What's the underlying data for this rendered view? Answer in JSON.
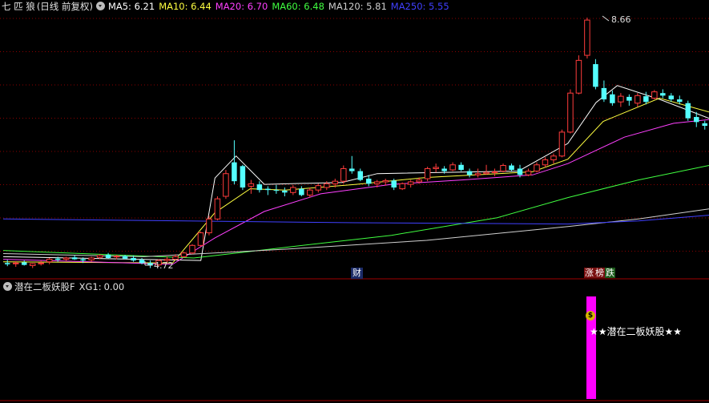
{
  "header": {
    "stock_name": "七 匹 狼",
    "period": "(日线 前复权)",
    "ma": [
      {
        "label": "MA5:",
        "value": "6.21",
        "color": "#ffffff"
      },
      {
        "label": "MA10:",
        "value": "6.44",
        "color": "#ffff40"
      },
      {
        "label": "MA20:",
        "value": "6.70",
        "color": "#ff40ff"
      },
      {
        "label": "MA60:",
        "value": "6.48",
        "color": "#40ff40"
      },
      {
        "label": "MA120:",
        "value": "5.81",
        "color": "#cfcfcf"
      },
      {
        "label": "MA250:",
        "value": "5.55",
        "color": "#4040ff"
      }
    ]
  },
  "indicator": {
    "name": "潜在二板妖股F",
    "xg_label": "XG1:",
    "xg_value": "0.00",
    "signal_text": "★★潜在二板妖股★★",
    "money_glyph": "$"
  },
  "annotations": {
    "high_price": "8.66",
    "low_price": "4.72",
    "tag_finance": "财",
    "tag_limit_1": "涨",
    "tag_limit_2": "榜",
    "tag_limit_3": "跌"
  },
  "colors": {
    "up": "#ff3c3c",
    "down": "#54ffff",
    "grid": "#8b0000",
    "signal_bar": "#ff00ff"
  },
  "chart_data": {
    "type": "candlestick",
    "ylim": [
      4.6,
      8.75
    ],
    "grid": true,
    "candles": [
      [
        4.8,
        4.85,
        4.75,
        4.78
      ],
      [
        4.79,
        4.83,
        4.74,
        4.8
      ],
      [
        4.81,
        4.84,
        4.76,
        4.77
      ],
      [
        4.76,
        4.8,
        4.72,
        4.79
      ],
      [
        4.8,
        4.84,
        4.76,
        4.8
      ],
      [
        4.82,
        4.88,
        4.78,
        4.86
      ],
      [
        4.87,
        4.9,
        4.82,
        4.85
      ],
      [
        4.86,
        4.9,
        4.83,
        4.88
      ],
      [
        4.89,
        4.92,
        4.85,
        4.86
      ],
      [
        4.86,
        4.89,
        4.8,
        4.84
      ],
      [
        4.85,
        4.9,
        4.82,
        4.88
      ],
      [
        4.89,
        4.94,
        4.86,
        4.92
      ],
      [
        4.93,
        4.96,
        4.87,
        4.88
      ],
      [
        4.9,
        4.93,
        4.86,
        4.91
      ],
      [
        4.91,
        4.93,
        4.86,
        4.87
      ],
      [
        4.88,
        4.92,
        4.82,
        4.84
      ],
      [
        4.85,
        4.88,
        4.78,
        4.8
      ],
      [
        4.8,
        4.84,
        4.72,
        4.76
      ],
      [
        4.77,
        4.86,
        4.74,
        4.84
      ],
      [
        4.84,
        4.9,
        4.8,
        4.86
      ],
      [
        4.86,
        4.94,
        4.84,
        4.9
      ],
      [
        4.9,
        4.98,
        4.88,
        4.96
      ],
      [
        4.96,
        5.1,
        4.94,
        5.08
      ],
      [
        5.08,
        5.3,
        5.06,
        5.28
      ],
      [
        5.28,
        5.55,
        5.24,
        5.5
      ],
      [
        5.5,
        5.86,
        5.48,
        5.82
      ],
      [
        5.86,
        6.28,
        5.82,
        6.22
      ],
      [
        6.4,
        6.75,
        6.05,
        6.1
      ],
      [
        6.34,
        6.36,
        5.96,
        6.0
      ],
      [
        6.02,
        6.12,
        5.9,
        6.06
      ],
      [
        6.05,
        6.1,
        5.92,
        5.96
      ],
      [
        5.98,
        6.02,
        5.88,
        5.96
      ],
      [
        5.96,
        6.04,
        5.9,
        5.95
      ],
      [
        5.95,
        6.0,
        5.86,
        5.92
      ],
      [
        5.92,
        6.04,
        5.88,
        6.0
      ],
      [
        5.98,
        6.02,
        5.86,
        5.88
      ],
      [
        5.88,
        6.0,
        5.84,
        5.96
      ],
      [
        5.96,
        6.06,
        5.92,
        6.03
      ],
      [
        6.0,
        6.1,
        5.96,
        6.06
      ],
      [
        6.06,
        6.14,
        6.0,
        6.1
      ],
      [
        6.1,
        6.35,
        6.06,
        6.3
      ],
      [
        6.3,
        6.5,
        6.22,
        6.26
      ],
      [
        6.26,
        6.3,
        6.1,
        6.12
      ],
      [
        6.14,
        6.2,
        6.02,
        6.06
      ],
      [
        6.06,
        6.12,
        6.0,
        6.09
      ],
      [
        6.09,
        6.14,
        6.03,
        6.11
      ],
      [
        6.11,
        6.14,
        5.96,
        6.0
      ],
      [
        5.98,
        6.08,
        5.96,
        6.06
      ],
      [
        6.05,
        6.12,
        6.0,
        6.09
      ],
      [
        6.09,
        6.16,
        6.06,
        6.12
      ],
      [
        6.14,
        6.33,
        6.1,
        6.3
      ],
      [
        6.3,
        6.38,
        6.24,
        6.32
      ],
      [
        6.3,
        6.34,
        6.22,
        6.26
      ],
      [
        6.28,
        6.4,
        6.26,
        6.36
      ],
      [
        6.36,
        6.4,
        6.26,
        6.28
      ],
      [
        6.26,
        6.3,
        6.16,
        6.2
      ],
      [
        6.2,
        6.3,
        6.16,
        6.22
      ],
      [
        6.22,
        6.36,
        6.2,
        6.24
      ],
      [
        6.24,
        6.3,
        6.18,
        6.25
      ],
      [
        6.26,
        6.38,
        6.24,
        6.35
      ],
      [
        6.35,
        6.38,
        6.26,
        6.28
      ],
      [
        6.3,
        6.36,
        6.16,
        6.2
      ],
      [
        6.2,
        6.3,
        6.18,
        6.26
      ],
      [
        6.26,
        6.4,
        6.24,
        6.36
      ],
      [
        6.36,
        6.48,
        6.32,
        6.44
      ],
      [
        6.44,
        6.54,
        6.38,
        6.5
      ],
      [
        6.5,
        6.92,
        6.48,
        6.88
      ],
      [
        6.88,
        7.56,
        6.86,
        7.5
      ],
      [
        7.5,
        8.1,
        7.48,
        8.02
      ],
      [
        8.1,
        8.7,
        8.05,
        8.66
      ],
      [
        7.96,
        8.04,
        7.56,
        7.6
      ],
      [
        7.58,
        7.7,
        7.36,
        7.4
      ],
      [
        7.48,
        7.54,
        7.3,
        7.34
      ],
      [
        7.36,
        7.5,
        7.28,
        7.45
      ],
      [
        7.44,
        7.48,
        7.3,
        7.38
      ],
      [
        7.34,
        7.5,
        7.28,
        7.46
      ],
      [
        7.45,
        7.52,
        7.32,
        7.36
      ],
      [
        7.42,
        7.55,
        7.4,
        7.52
      ],
      [
        7.5,
        7.56,
        7.42,
        7.46
      ],
      [
        7.46,
        7.5,
        7.36,
        7.4
      ],
      [
        7.4,
        7.46,
        7.32,
        7.36
      ],
      [
        7.34,
        7.38,
        7.06,
        7.1
      ],
      [
        7.12,
        7.2,
        6.96,
        7.04
      ],
      [
        7.02,
        7.06,
        6.92,
        6.98
      ]
    ],
    "ma_series": [
      {
        "name": "MA5",
        "color": "#ffffff",
        "values": [
          [
            0,
            4.9
          ],
          [
            0.28,
            4.84
          ],
          [
            0.3,
            6.15
          ],
          [
            0.33,
            6.5
          ],
          [
            0.37,
            6.05
          ],
          [
            0.48,
            6.08
          ],
          [
            0.53,
            6.22
          ],
          [
            0.73,
            6.26
          ],
          [
            0.8,
            6.7
          ],
          [
            0.84,
            7.35
          ],
          [
            0.87,
            7.62
          ],
          [
            0.93,
            7.4
          ],
          [
            1.0,
            7.1
          ]
        ]
      },
      {
        "name": "MA10",
        "color": "#ffff40",
        "values": [
          [
            0,
            4.82
          ],
          [
            0.24,
            4.8
          ],
          [
            0.3,
            5.6
          ],
          [
            0.35,
            5.98
          ],
          [
            0.4,
            5.96
          ],
          [
            0.5,
            6.05
          ],
          [
            0.6,
            6.16
          ],
          [
            0.75,
            6.25
          ],
          [
            0.8,
            6.45
          ],
          [
            0.85,
            7.05
          ],
          [
            0.93,
            7.42
          ],
          [
            1.0,
            7.2
          ]
        ]
      },
      {
        "name": "MA20",
        "color": "#ff40ff",
        "values": [
          [
            0,
            4.86
          ],
          [
            0.24,
            4.78
          ],
          [
            0.3,
            5.2
          ],
          [
            0.37,
            5.62
          ],
          [
            0.45,
            5.9
          ],
          [
            0.55,
            6.05
          ],
          [
            0.65,
            6.12
          ],
          [
            0.75,
            6.2
          ],
          [
            0.8,
            6.38
          ],
          [
            0.88,
            6.8
          ],
          [
            0.95,
            7.02
          ],
          [
            1.0,
            7.08
          ]
        ]
      },
      {
        "name": "MA60",
        "color": "#40ff40",
        "values": [
          [
            0,
            5.0
          ],
          [
            0.27,
            4.88
          ],
          [
            0.4,
            5.05
          ],
          [
            0.55,
            5.24
          ],
          [
            0.7,
            5.52
          ],
          [
            0.8,
            5.84
          ],
          [
            0.9,
            6.12
          ],
          [
            1.0,
            6.35
          ]
        ]
      },
      {
        "name": "MA120",
        "color": "#d0d0d0",
        "values": [
          [
            0,
            4.95
          ],
          [
            0.2,
            4.9
          ],
          [
            0.4,
            5.02
          ],
          [
            0.6,
            5.16
          ],
          [
            0.8,
            5.38
          ],
          [
            0.9,
            5.5
          ],
          [
            1.0,
            5.66
          ]
        ]
      },
      {
        "name": "MA250",
        "color": "#4040ff",
        "values": [
          [
            0,
            5.5
          ],
          [
            0.5,
            5.44
          ],
          [
            0.8,
            5.42
          ],
          [
            0.9,
            5.47
          ],
          [
            1.0,
            5.56
          ]
        ]
      }
    ]
  }
}
